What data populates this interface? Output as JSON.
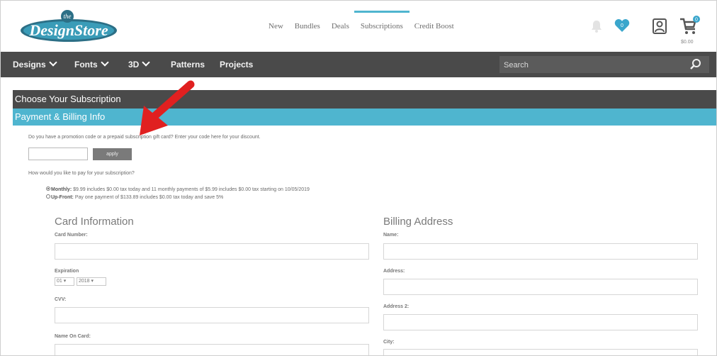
{
  "header": {
    "logo_top": "the",
    "logo_text": "DesignStore",
    "nav": [
      {
        "label": "New"
      },
      {
        "label": "Bundles"
      },
      {
        "label": "Deals"
      },
      {
        "label": "Subscriptions",
        "active": true
      },
      {
        "label": "Credit Boost"
      }
    ],
    "cart_price": "$0.00",
    "wishlist_count": "0",
    "cart_count": "0"
  },
  "mainnav": {
    "items": [
      "Designs",
      "Fonts",
      "3D",
      "Patterns",
      "Projects"
    ],
    "search_placeholder": "Search"
  },
  "sections": {
    "choose": "Choose Your Subscription",
    "payment": "Payment & Billing Info"
  },
  "promo": {
    "question": "Do you have a promotion code or a prepaid subscription gift card? Enter your code here for your discount.",
    "apply_label": "apply"
  },
  "pay": {
    "question": "How would you like to pay for your subscription?",
    "monthly_label": "Monthly:",
    "monthly_text": "$9.99 includes $0.00 tax today and 11  monthly payments of $5.99 includes $0.00 tax  starting on 10/05/2019",
    "upfront_label": "Up-Front:",
    "upfront_text": "Pay one payment of $133.89 includes $0.00 tax  today and save 5%"
  },
  "card": {
    "title": "Card Information",
    "number_label": "Card Number:",
    "expiration_label": "Expiration",
    "month": "01",
    "year": "2018",
    "cvv_label": "CVV:",
    "name_label": "Name On Card:"
  },
  "billing": {
    "title": "Billing Address",
    "name_label": "Name:",
    "address_label": "Address:",
    "address2_label": "Address 2:",
    "city_label": "City:"
  },
  "colors": {
    "accent": "#4fb5cf",
    "dark": "#4a4a4a",
    "annotation": "#e02020"
  }
}
